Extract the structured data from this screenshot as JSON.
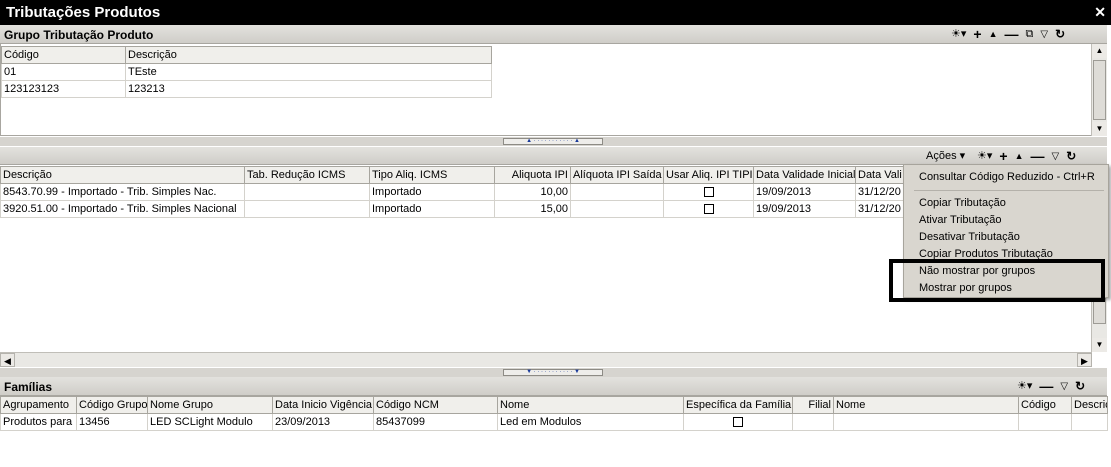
{
  "window": {
    "title": "Tributações Produtos",
    "close_glyph": "✕"
  },
  "toolbar_icons": {
    "wave": "☀▾",
    "plus": "+",
    "up": "▲",
    "minus": "—",
    "copy": "⧉",
    "filter": "▽",
    "refresh": "↻"
  },
  "grupo_panel": {
    "title": "Grupo Tributação Produto",
    "columns": [
      "Código",
      "Descrição"
    ],
    "rows": [
      [
        "01",
        "TEste"
      ],
      [
        "123123123",
        "123213"
      ]
    ]
  },
  "tributacao_panel": {
    "acoes_label": "Ações ▾",
    "columns": [
      "Descrição",
      "Tab. Redução ICMS",
      "Tipo Aliq. ICMS",
      "Aliquota IPI",
      "Alíquota IPI Saída",
      "Usar Aliq. IPI TIPI",
      "Data Validade Inicial",
      "Data Vali"
    ],
    "rows": [
      {
        "descricao": "8543.70.99 - Importado - Trib. Simples Nac.",
        "tab_reducao": "",
        "tipo_aliq": "Importado",
        "aliquota_ipi": "10,00",
        "aliquota_saida": "",
        "usar_tipi": false,
        "data_inicial": "19/09/2013",
        "data_final": "31/12/20"
      },
      {
        "descricao": "3920.51.00 - Importado - Trib. Simples Nacional",
        "tab_reducao": "",
        "tipo_aliq": "Importado",
        "aliquota_ipi": "15,00",
        "aliquota_saida": "",
        "usar_tipi": false,
        "data_inicial": "19/09/2013",
        "data_final": "31/12/20"
      }
    ]
  },
  "context_menu": {
    "items": [
      "Consultar Código Reduzido - Ctrl+R",
      "Copiar Tributação",
      "Ativar Tributação",
      "Desativar Tributação",
      "Copiar Produtos Tributação",
      "Não mostrar por grupos",
      "Mostrar por grupos"
    ]
  },
  "familias_panel": {
    "title": "Famílias",
    "columns": [
      "Agrupamento",
      "Código Grupo",
      "Nome Grupo",
      "Data Inicio Vigência",
      "Código NCM",
      "Nome",
      "Específica da Família",
      "Filial",
      "Nome",
      "Código",
      "Descric"
    ],
    "rows": [
      {
        "agrupamento": "Produtos para F",
        "codigo_grupo": "13456",
        "nome_grupo": "LED SCLight Modulo",
        "data_inicio": "23/09/2013",
        "codigo_ncm": "85437099",
        "nome": "Led em Modulos",
        "especifica": false,
        "filial": "",
        "nome2": "",
        "codigo": "",
        "descric": ""
      }
    ]
  }
}
